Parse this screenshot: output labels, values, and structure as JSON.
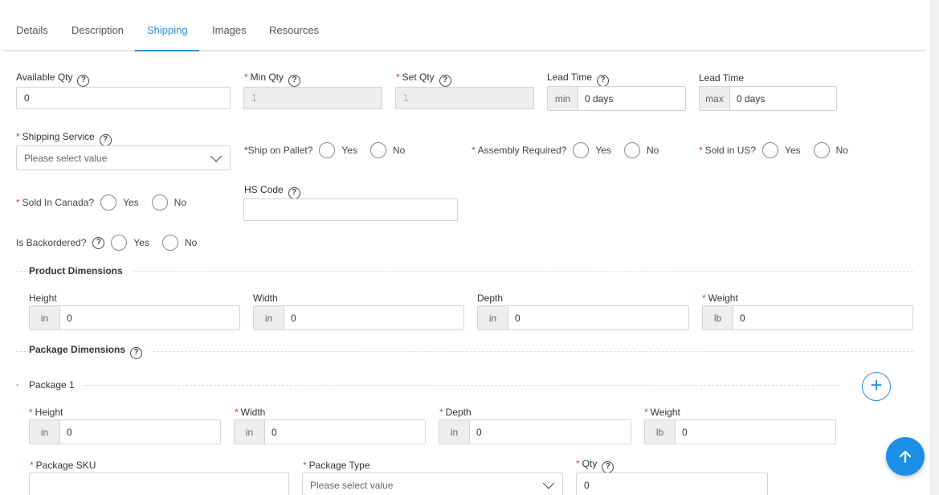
{
  "tabs": [
    "Details",
    "Description",
    "Shipping",
    "Images",
    "Resources"
  ],
  "fields": {
    "available_qty": {
      "label": "Available Qty",
      "value": "0"
    },
    "min_qty": {
      "label": "Min Qty",
      "value": "1"
    },
    "set_qty": {
      "label": "Set Qty",
      "value": "1"
    },
    "lead_time_min": {
      "label": "Lead Time",
      "addon": "min",
      "value": "0 days"
    },
    "lead_time_max": {
      "label": "Lead Time",
      "addon": "max",
      "value": "0 days"
    },
    "shipping_service": {
      "label": "Shipping Service",
      "placeholder": "Please select value"
    },
    "ship_on_pallet": {
      "label": "*Ship on Pallet?"
    },
    "assembly_required": {
      "label": "Assembly Required?"
    },
    "sold_in_us": {
      "label": "Sold in US?"
    },
    "sold_in_canada": {
      "label": "Sold In Canada?"
    },
    "hs_code": {
      "label": "HS Code",
      "value": ""
    },
    "is_backordered": {
      "label": "Is Backordered?"
    },
    "yes": "Yes",
    "no": "No"
  },
  "product_dimensions": {
    "title": "Product Dimensions",
    "height": {
      "label": "Height",
      "unit": "in",
      "value": "0"
    },
    "width": {
      "label": "Width",
      "unit": "in",
      "value": "0"
    },
    "depth": {
      "label": "Depth",
      "unit": "in",
      "value": "0"
    },
    "weight": {
      "label": "Weight",
      "unit": "lb",
      "value": "0"
    }
  },
  "package_dimensions": {
    "title": "Package Dimensions",
    "package_title": "Package 1",
    "collapse_mark": "-",
    "height": {
      "label": "Height",
      "unit": "in",
      "value": "0"
    },
    "width": {
      "label": "Width",
      "unit": "in",
      "value": "0"
    },
    "depth": {
      "label": "Depth",
      "unit": "in",
      "value": "0"
    },
    "weight": {
      "label": "Weight",
      "unit": "lb",
      "value": "0"
    },
    "package_sku": {
      "label": "Package SKU",
      "value": ""
    },
    "package_type": {
      "label": "Package Type",
      "placeholder": "Please select value"
    },
    "qty": {
      "label": "Qty",
      "value": "0"
    }
  },
  "icons": {
    "help": "?",
    "add": "+",
    "up_arrow": "arrow-up"
  },
  "colors": {
    "accent": "#2d8fd5",
    "required": "#e0443a",
    "fab": "#1b8fe8"
  }
}
